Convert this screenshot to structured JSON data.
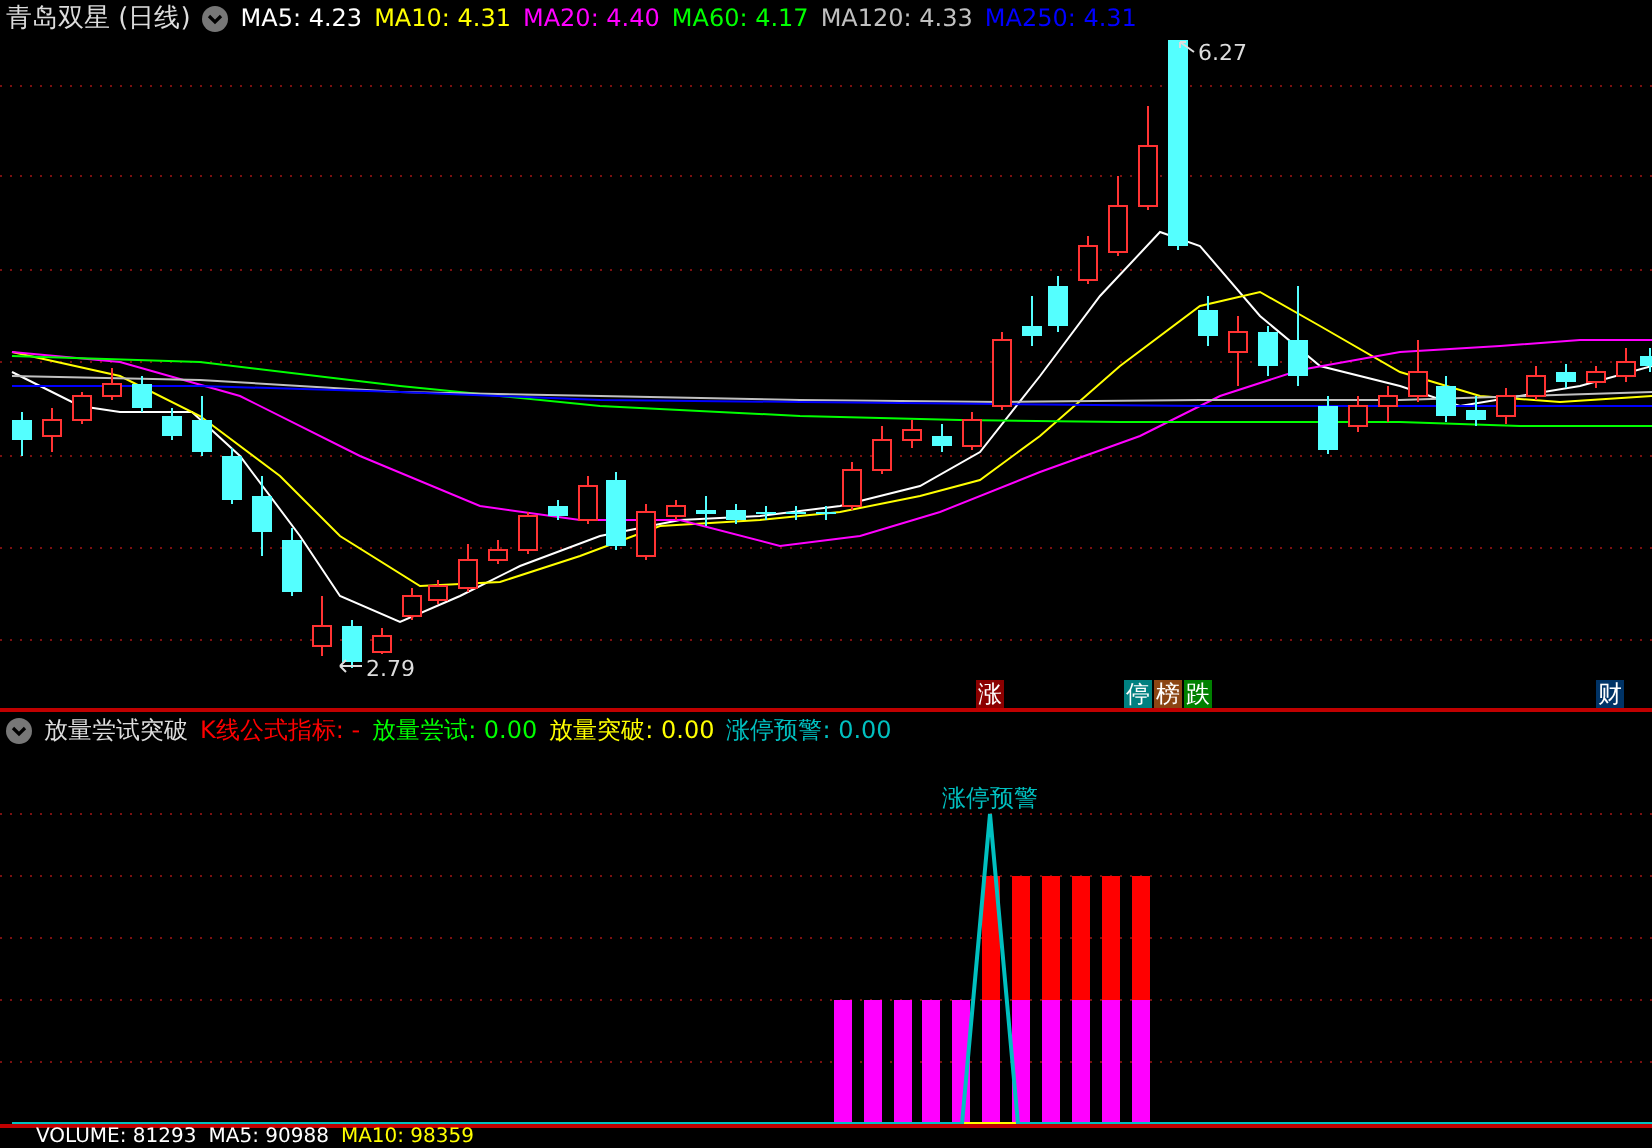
{
  "title_bar": {
    "stock": "青岛双星 (日线)",
    "indicators": [
      {
        "label": "MA5: 4.23",
        "color": "#ffffff"
      },
      {
        "label": "MA10: 4.31",
        "color": "#ffff00"
      },
      {
        "label": "MA20: 4.40",
        "color": "#ff00ff"
      },
      {
        "label": "MA60: 4.17",
        "color": "#00ff00"
      },
      {
        "label": "MA120: 4.33",
        "color": "#c0c0c0"
      },
      {
        "label": "MA250: 4.31",
        "color": "#0000ff"
      }
    ]
  },
  "price_chart": {
    "high_label": "6.27",
    "low_label": "2.79"
  },
  "markers": [
    {
      "label": "涨",
      "color": "#8b0000"
    },
    {
      "label": "停",
      "color": "#008080"
    },
    {
      "label": "榜",
      "color": "#8b4513"
    },
    {
      "label": "跌",
      "color": "#008000"
    },
    {
      "label": "财",
      "color": "#003366"
    }
  ],
  "indicator_panel": {
    "name": "放量尝试突破",
    "values": [
      {
        "label": "K线公式指标: -",
        "color": "#ff0000"
      },
      {
        "label": "放量尝试: 0.00",
        "color": "#00ff00"
      },
      {
        "label": "放量突破: 0.00",
        "color": "#ffff00"
      },
      {
        "label": "涨停预警: 0.00",
        "color": "#00c0c0"
      }
    ],
    "chart_label": "涨停预警"
  },
  "volume_panel": {
    "values": [
      {
        "label": "VOLUME: 81293",
        "color": "#ffffff"
      },
      {
        "label": "MA5: 90988",
        "color": "#ffffff"
      },
      {
        "label": "MA10: 98359",
        "color": "#ffff00"
      }
    ]
  }
}
